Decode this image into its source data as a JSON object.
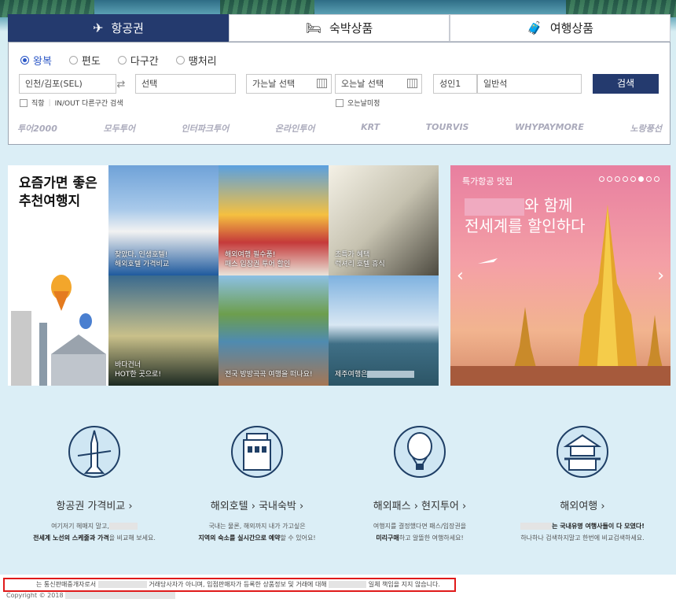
{
  "tabs": [
    {
      "label": "항공권",
      "icon": "airplane-icon",
      "active": true
    },
    {
      "label": "숙박상품",
      "icon": "car-bed-icon",
      "active": false
    },
    {
      "label": "여행상품",
      "icon": "luggage-icon",
      "active": false
    }
  ],
  "trip_types": [
    {
      "label": "왕복",
      "selected": true
    },
    {
      "label": "편도",
      "selected": false
    },
    {
      "label": "다구간",
      "selected": false
    },
    {
      "label": "땡처리",
      "selected": false
    }
  ],
  "search": {
    "origin": "인천/김포(SEL)",
    "destination": "선택",
    "depart_date": "가는날 선택",
    "return_date": "오는날 선택",
    "passengers": "성인1",
    "cabin": "일반석",
    "button": "검색",
    "direct_label": "직항",
    "inout_label": "IN/OUT 다른구간 검색",
    "undecided_label": "오는날미정"
  },
  "partners": [
    "투어2000",
    "모두투어",
    "인터파크투어",
    "온라인투어",
    "KRT",
    "TOURVIS",
    "WHYPAYMORE",
    "노랑풍선"
  ],
  "promo": {
    "title": "요즘가면 좋은\n추천여행지",
    "tiles": [
      {
        "caption": "찾았다, 인생호텔!\n해외호텔 가격비교"
      },
      {
        "caption": "해외여행 필수품!\n패스 입장권 투어 할인"
      },
      {
        "caption": "초특가 혜택\n럭셔리 호텔 휴식"
      },
      {
        "caption": "바다건너\nHOT한 곳으로!"
      },
      {
        "caption": "전국 방방곡곡 여행을 떠나요!"
      },
      {
        "caption": "제주여행은"
      }
    ]
  },
  "banner": {
    "header": "특가항공 맛집",
    "line1_suffix": "와 함께",
    "line2": "전세계를 할인하다",
    "slide_count": 8,
    "active_slide": 6
  },
  "services": [
    {
      "title": "항공권 가격비교 ›",
      "icon": "airplane-circle-icon",
      "desc_line1": "여기저기 헤매지 말고,",
      "desc_bold": "전세계 노선의 스케줄과 가격",
      "desc_line2": "을 비교해 보세요."
    },
    {
      "title": "해외호텔 ›  국내숙박 ›",
      "icon": "hotel-circle-icon",
      "desc_line1": "국내는 물론, 해외까지 내가 가고싶은",
      "desc_bold": "지역의 숙소를 실시간으로 예약",
      "desc_line2": "할 수 있어요!"
    },
    {
      "title": "해외패스 ›  현지투어 ›",
      "icon": "balloon-circle-icon",
      "desc_line1": "여행지를 결정했다면 패스/입장권을",
      "desc_bold": "미리구매",
      "desc_line2": "하고 알뜰한 여행하세요!"
    },
    {
      "title": "해외여행 ›",
      "icon": "pagoda-circle-icon",
      "desc_line1": "는 국내유명 여행사들이 다 모였다!",
      "desc_bold": "한번에 비교검색",
      "desc_line2": "하나하나 검색하지말고 한번에 비교검색하세요."
    }
  ],
  "footer": {
    "notice_a": "는 통신판매중개자로서",
    "notice_b": "거래당사자가 아니며, 입점판매자가 등록한 상품정보 및 거래에 대해",
    "notice_c": "일체 책임을 지지 않습니다.",
    "copyright": "Copyright © 2018"
  },
  "colors": {
    "navy": "#243a6e",
    "accent_blue": "#2a56c6",
    "notice_red": "#e01a1a"
  }
}
